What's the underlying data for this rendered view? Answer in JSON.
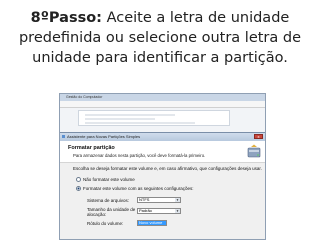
{
  "slide": {
    "heading_bold": "8ºPasso:",
    "heading_line1": "Aceite a letra de unidade",
    "heading_line2": "predefinida ou selecione outra letra de",
    "heading_line3": "unidade para identificar a partição."
  },
  "background_window": {
    "title": "Gestão do Computador"
  },
  "wizard": {
    "title": "Assistente para Novas Partições Simples",
    "header_title": "Formatar partição",
    "header_subtitle": "Para armazenar dados nesta partição, você deve formatá-la primeiro.",
    "prompt": "Escolha se deseja formatar este volume e, em caso afirmativo, que configurações deseja usar.",
    "option_no_format": "Não formatar este volume",
    "option_format": "Formatar este volume com as seguintes configurações:",
    "selected_option": "format",
    "file_system_label": "Sistema de arquivos:",
    "file_system_value": "NTFS",
    "allocation_label_1": "Tamanho da unidade de",
    "allocation_label_2": "alocação:",
    "allocation_value": "Padrão",
    "volume_label_label": "Rótulo do volume:",
    "volume_label_value": "Novo volume",
    "close_glyph": "x"
  }
}
